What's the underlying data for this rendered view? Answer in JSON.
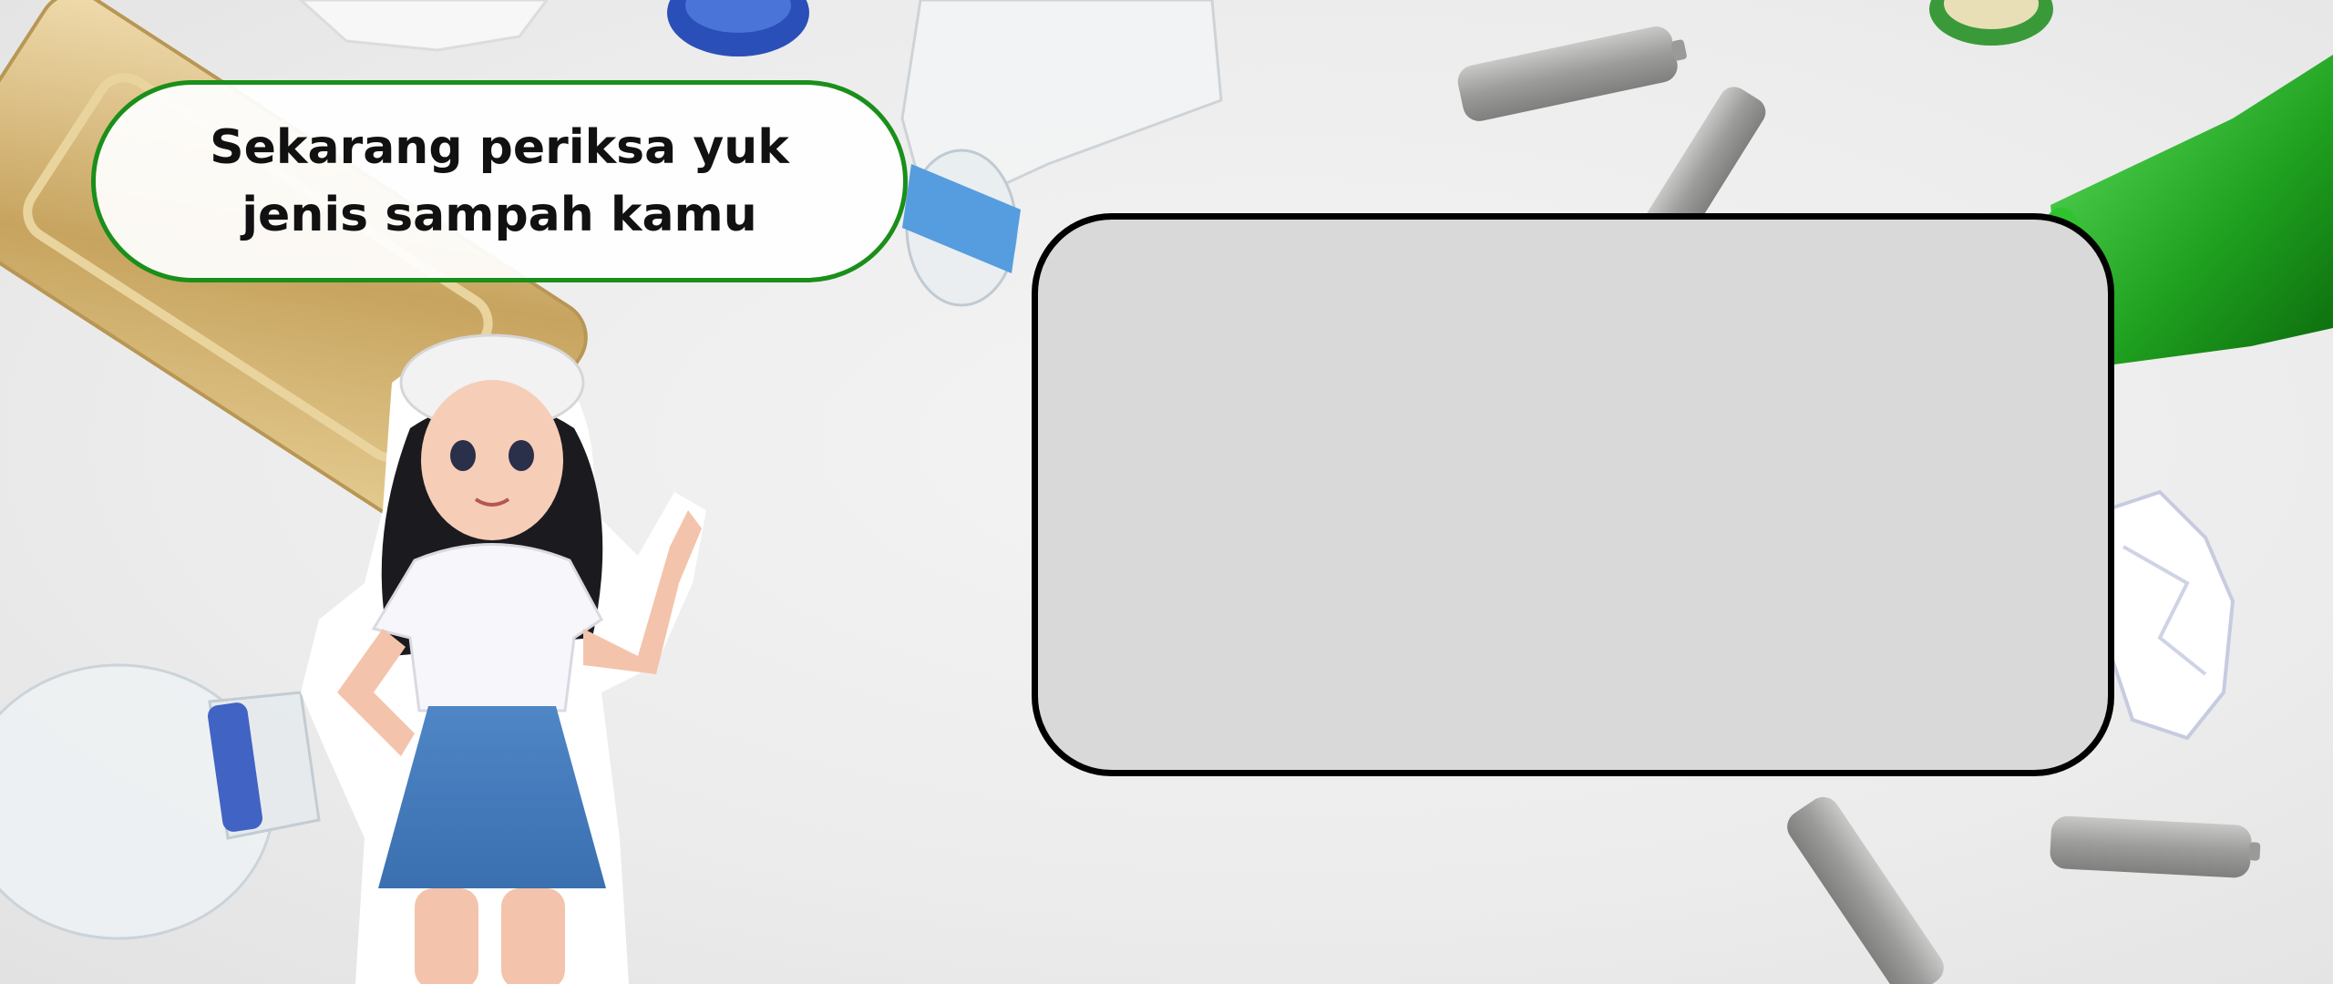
{
  "prompt": {
    "text": "Sekarang periksa yuk jenis sampah kamu"
  },
  "scan_panel": {
    "content": ""
  },
  "palette": {
    "bubble_border": "#1a8f1a",
    "panel_fill": "#d9d9d9",
    "panel_border": "#000000"
  },
  "background": {
    "items": [
      "plastic-bottle",
      "aluminium-tray",
      "green-glass-bottle",
      "battery",
      "crumpled-paper",
      "plastic-cap",
      "bottle-cap"
    ]
  },
  "mascot": {
    "description_icon": "girl-mascot-illustration"
  }
}
